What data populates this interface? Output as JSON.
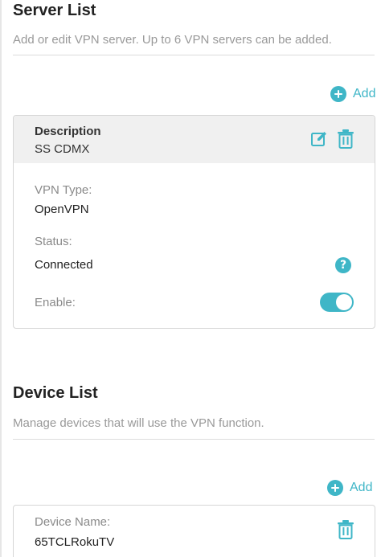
{
  "server_section": {
    "title": "Server List",
    "description": "Add or edit VPN server. Up to 6 VPN servers can be added.",
    "add_label": "Add",
    "server": {
      "description_label": "Description",
      "description_value": "SS CDMX",
      "vpn_type_label": "VPN Type:",
      "vpn_type_value": "OpenVPN",
      "status_label": "Status:",
      "status_value": "Connected",
      "enable_label": "Enable:",
      "enabled": true
    }
  },
  "device_section": {
    "title": "Device List",
    "description": "Manage devices that will use the VPN function.",
    "add_label": "Add",
    "device": {
      "name_label": "Device Name:",
      "name_value": "65TCLRokuTV"
    }
  },
  "icons": {
    "accent_color": "#3fb6c7",
    "help": "?"
  }
}
